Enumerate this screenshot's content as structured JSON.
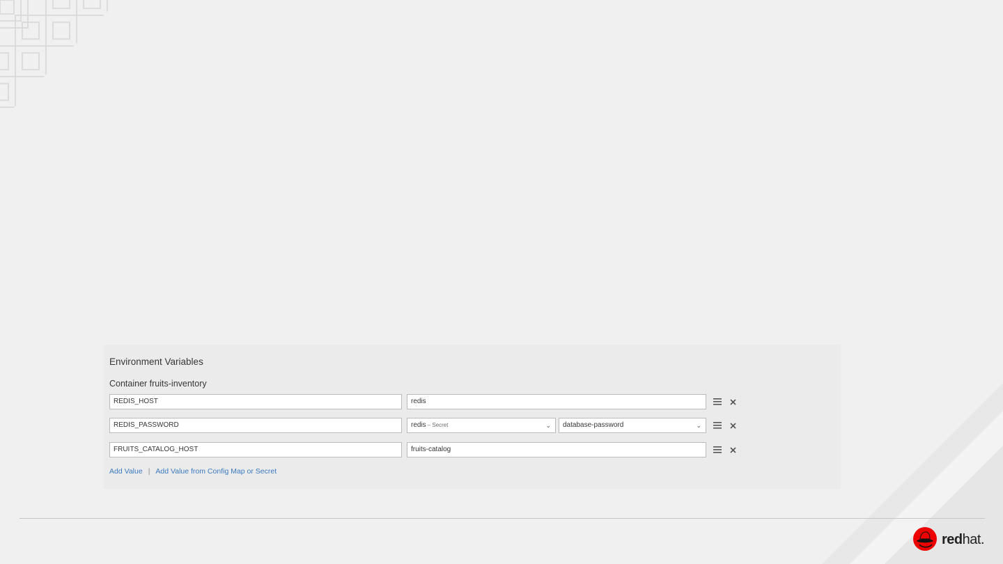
{
  "env_panel": {
    "title": "Environment Variables",
    "container_label": "Container fruits-inventory",
    "rows": [
      {
        "name": "REDIS_HOST",
        "value": "redis"
      },
      {
        "name": "REDIS_PASSWORD",
        "resource": "redis",
        "resource_type": "– Secret",
        "key": "database-password"
      },
      {
        "name": "FRUITS_CATALOG_HOST",
        "value": "fruits-catalog"
      }
    ],
    "add_value_link": "Add Value",
    "separator": "|",
    "add_from_link": "Add Value from Config Map or Secret"
  },
  "logo": {
    "word_bold": "red",
    "word_light": "hat",
    "suffix": "."
  },
  "colors": {
    "background": "#f0f0f0",
    "panel": "#ebebeb",
    "link": "#3a79bf",
    "brand_red": "#ee0000"
  }
}
